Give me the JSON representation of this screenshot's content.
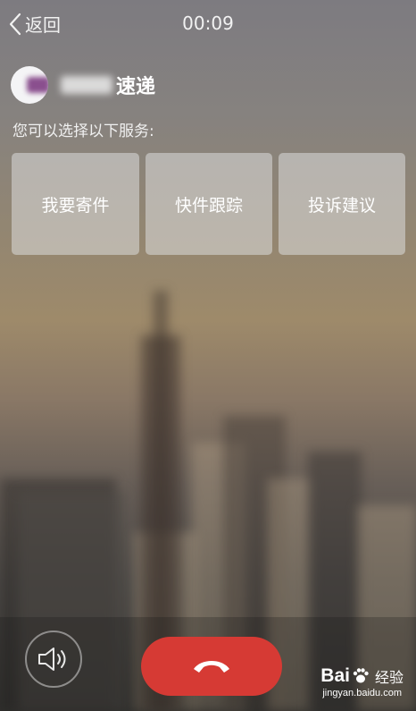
{
  "header": {
    "back_label": "返回",
    "timer": "00:09"
  },
  "caller": {
    "name_visible": "速递",
    "avatar_color": "#8a4f8e"
  },
  "prompt": "您可以选择以下服务:",
  "services": [
    {
      "label": "我要寄件"
    },
    {
      "label": "快件跟踪"
    },
    {
      "label": "投诉建议"
    }
  ],
  "controls": {
    "speaker_icon": "speaker-icon",
    "hangup_icon": "phone-hangup-icon",
    "hangup_color": "#d63a34"
  },
  "watermark": {
    "brand": "Bai",
    "brand_suffix": "经验",
    "url": "jingyan.baidu.com"
  }
}
